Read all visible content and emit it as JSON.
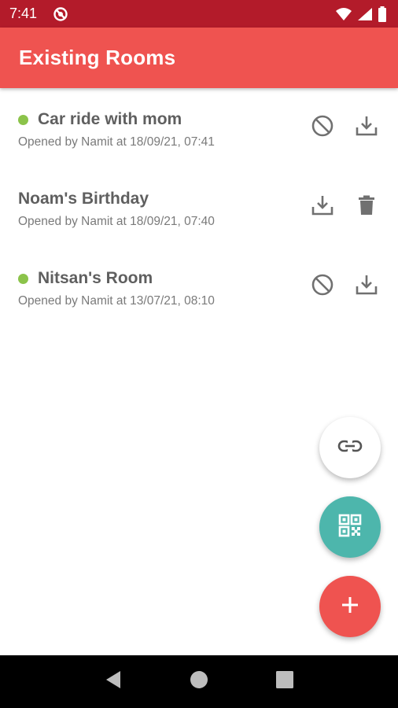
{
  "status_bar": {
    "time": "7:41",
    "icons": [
      "do-not-disturb-icon",
      "wifi-icon",
      "signal-icon",
      "battery-icon"
    ]
  },
  "app_bar": {
    "title": "Existing Rooms",
    "color": "#ef5350"
  },
  "rooms": [
    {
      "name": "Car ride with mom",
      "subtitle": "Opened by Namit at 18/09/21, 07:41",
      "active": true,
      "actions": [
        "block-icon",
        "download-icon"
      ]
    },
    {
      "name": "Noam's Birthday",
      "subtitle": "Opened by Namit at 18/09/21, 07:40",
      "active": false,
      "actions": [
        "download-icon",
        "delete-icon"
      ]
    },
    {
      "name": "Nitsan's Room",
      "subtitle": "Opened by Namit at 13/07/21, 08:10",
      "active": true,
      "actions": [
        "block-icon",
        "download-icon"
      ]
    }
  ],
  "fabs": {
    "link": {
      "icon": "link-icon",
      "color": "#ffffff"
    },
    "qr": {
      "icon": "qr-code-icon",
      "color": "#4db6ac"
    },
    "add": {
      "icon": "plus-icon",
      "color": "#ef5350"
    }
  },
  "colors": {
    "status_bar": "#b31b2a",
    "active_dot": "#8bc34a",
    "icon_gray": "#707070"
  }
}
